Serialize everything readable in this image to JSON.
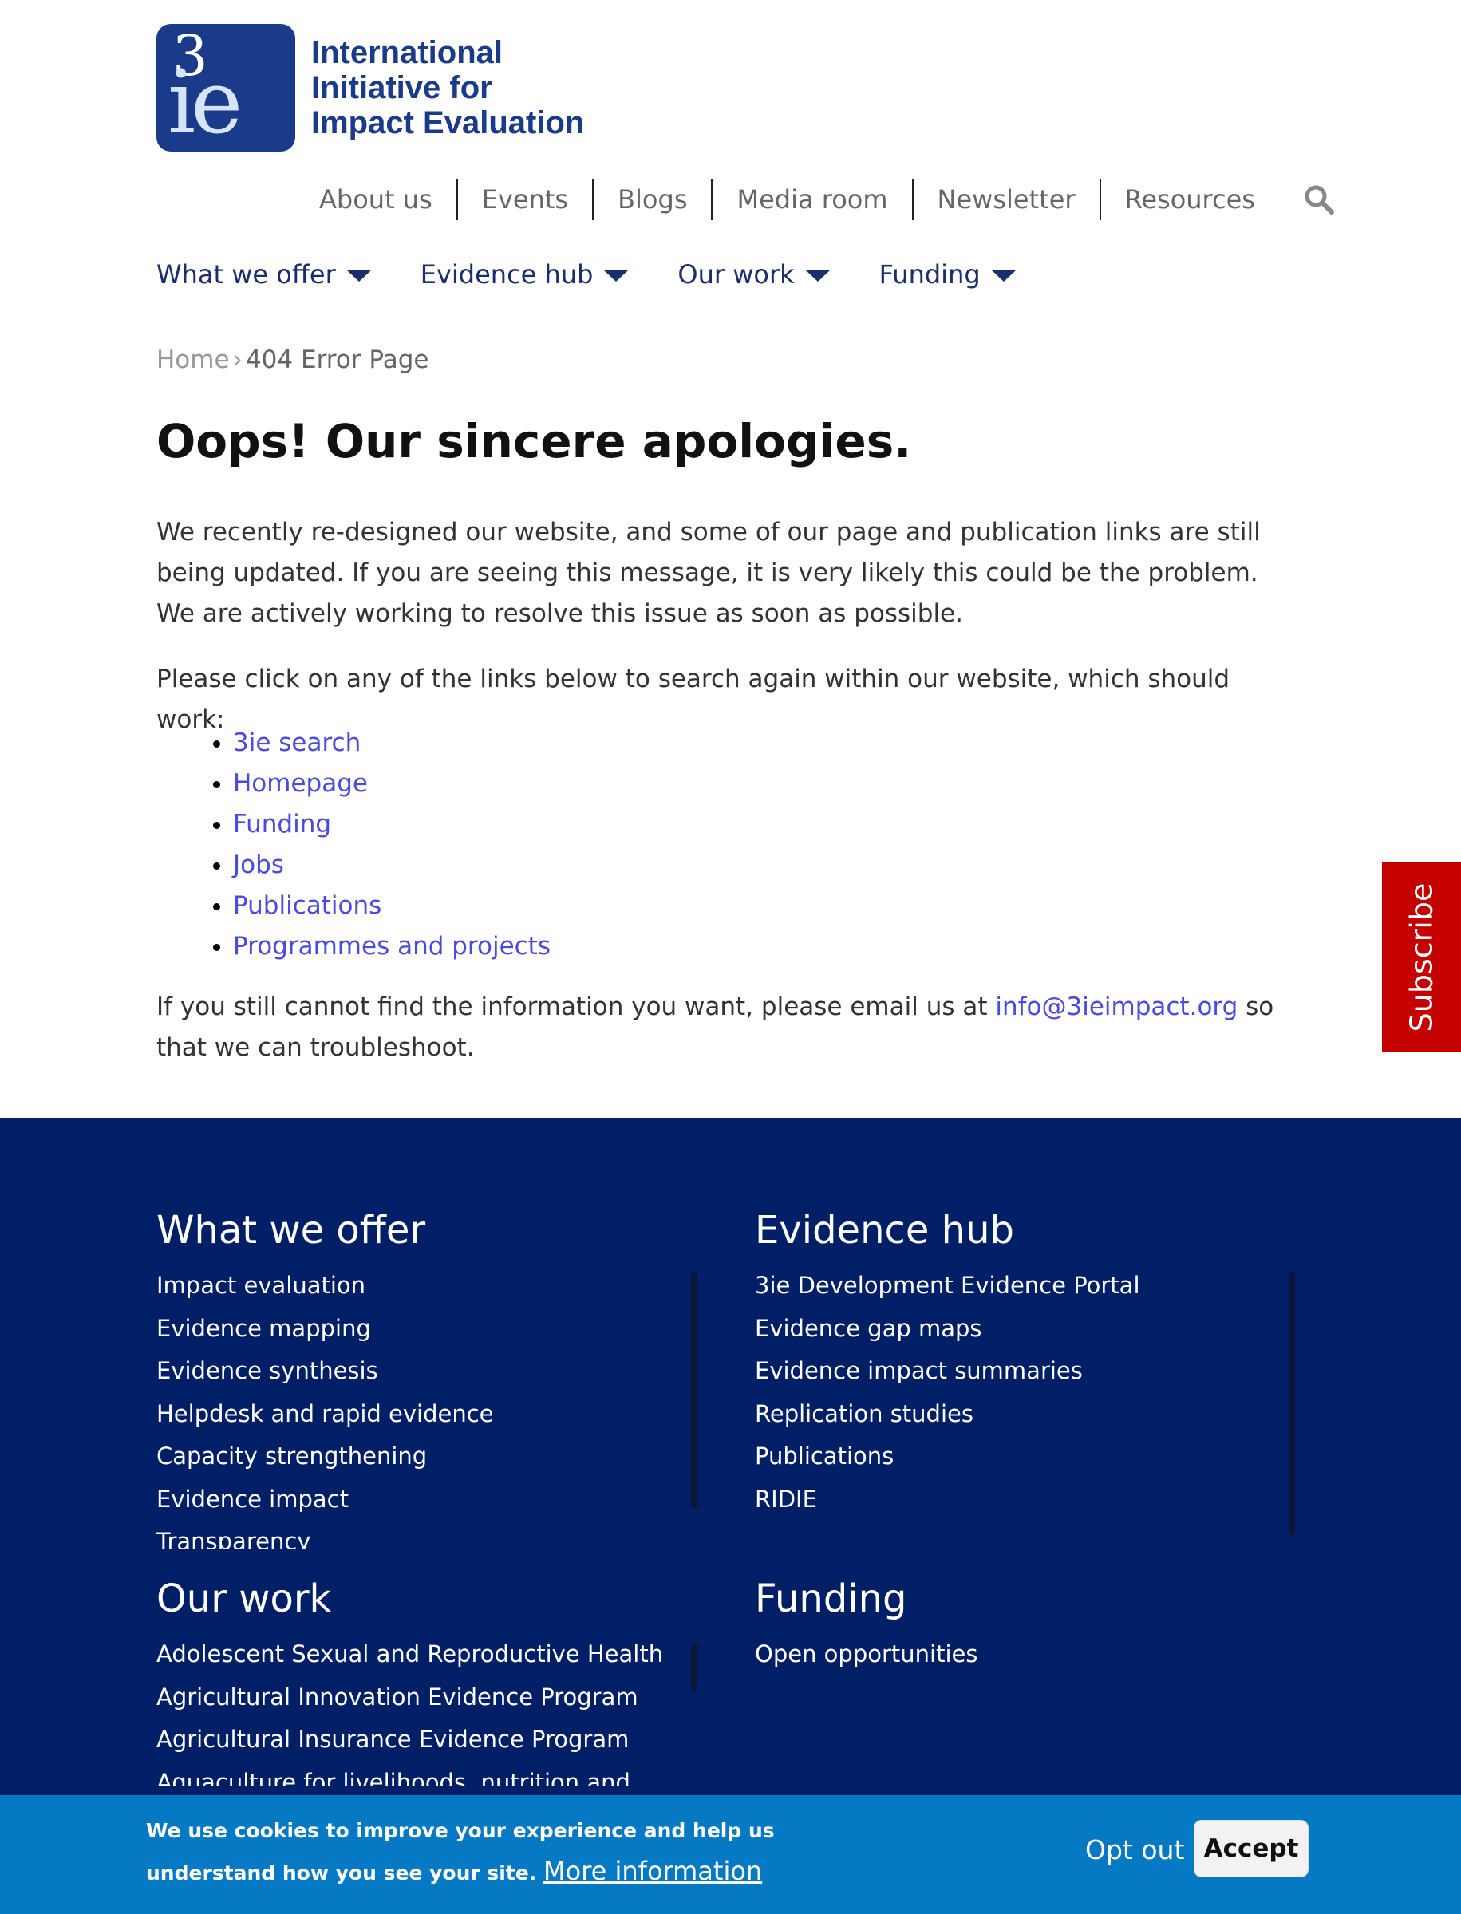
{
  "logo": {
    "mark_top": "3",
    "mark_main": "ie",
    "line1": "International",
    "line2": "Initiative for",
    "line3": "Impact Evaluation"
  },
  "topnav": {
    "items": [
      "About us",
      "Events",
      "Blogs",
      "Media room",
      "Newsletter",
      "Resources"
    ],
    "search_icon": "search-icon"
  },
  "mainnav": {
    "items": [
      "What we offer",
      "Evidence hub",
      "Our work",
      "Funding"
    ]
  },
  "breadcrumb": {
    "home": "Home",
    "separator": "›",
    "current": "404 Error Page"
  },
  "page": {
    "title": "Oops! Our sincere apologies.",
    "paragraph1": "We recently re-designed our website, and some of our page and publication links are still being updated. If you are seeing this message, it is very likely this could be the problem. We are actively working to resolve this issue as soon as possible.",
    "paragraph2": "Please click on any of the links below to search again within our website, which should work:",
    "links": [
      "3ie search",
      "Homepage",
      "Funding",
      "Jobs",
      "Publications",
      "Programmes and projects"
    ],
    "paragraph3_before": "If you still cannot find the information you want, please email us at ",
    "email": "info@3ieimpact.org",
    "paragraph3_after": " so that we can troubleshoot."
  },
  "subscribe": {
    "label": "Subscribe"
  },
  "footer": {
    "what_we_offer": {
      "heading": "What we offer",
      "items": [
        "Impact evaluation",
        "Evidence mapping",
        "Evidence synthesis",
        "Helpdesk and rapid evidence",
        "Capacity strengthening",
        "Evidence impact",
        "Transparency"
      ]
    },
    "evidence_hub": {
      "heading": "Evidence hub",
      "items": [
        "3ie Development Evidence Portal",
        "Evidence gap maps",
        "Evidence impact summaries",
        "Replication studies",
        "Publications",
        "RIDIE"
      ]
    },
    "our_work": {
      "heading": "Our work",
      "items": [
        "Adolescent Sexual and Reproductive Health",
        "Agricultural Innovation Evidence Program",
        "Agricultural Insurance Evidence Program",
        "Aquaculture for livelihoods, nutrition and"
      ]
    },
    "funding": {
      "heading": "Funding",
      "items": [
        "Open opportunities"
      ]
    }
  },
  "cookie": {
    "message": "We use cookies to improve your experience and help us understand how you see your site.",
    "more_info": "More information",
    "opt_out": "Opt out",
    "accept": "Accept"
  },
  "colors": {
    "brand_blue": "#1a3a8a",
    "footer_bg": "#001f66",
    "link": "#4a4ae0",
    "subscribe_bg": "#c40000",
    "cookie_bg": "#0679c4"
  }
}
